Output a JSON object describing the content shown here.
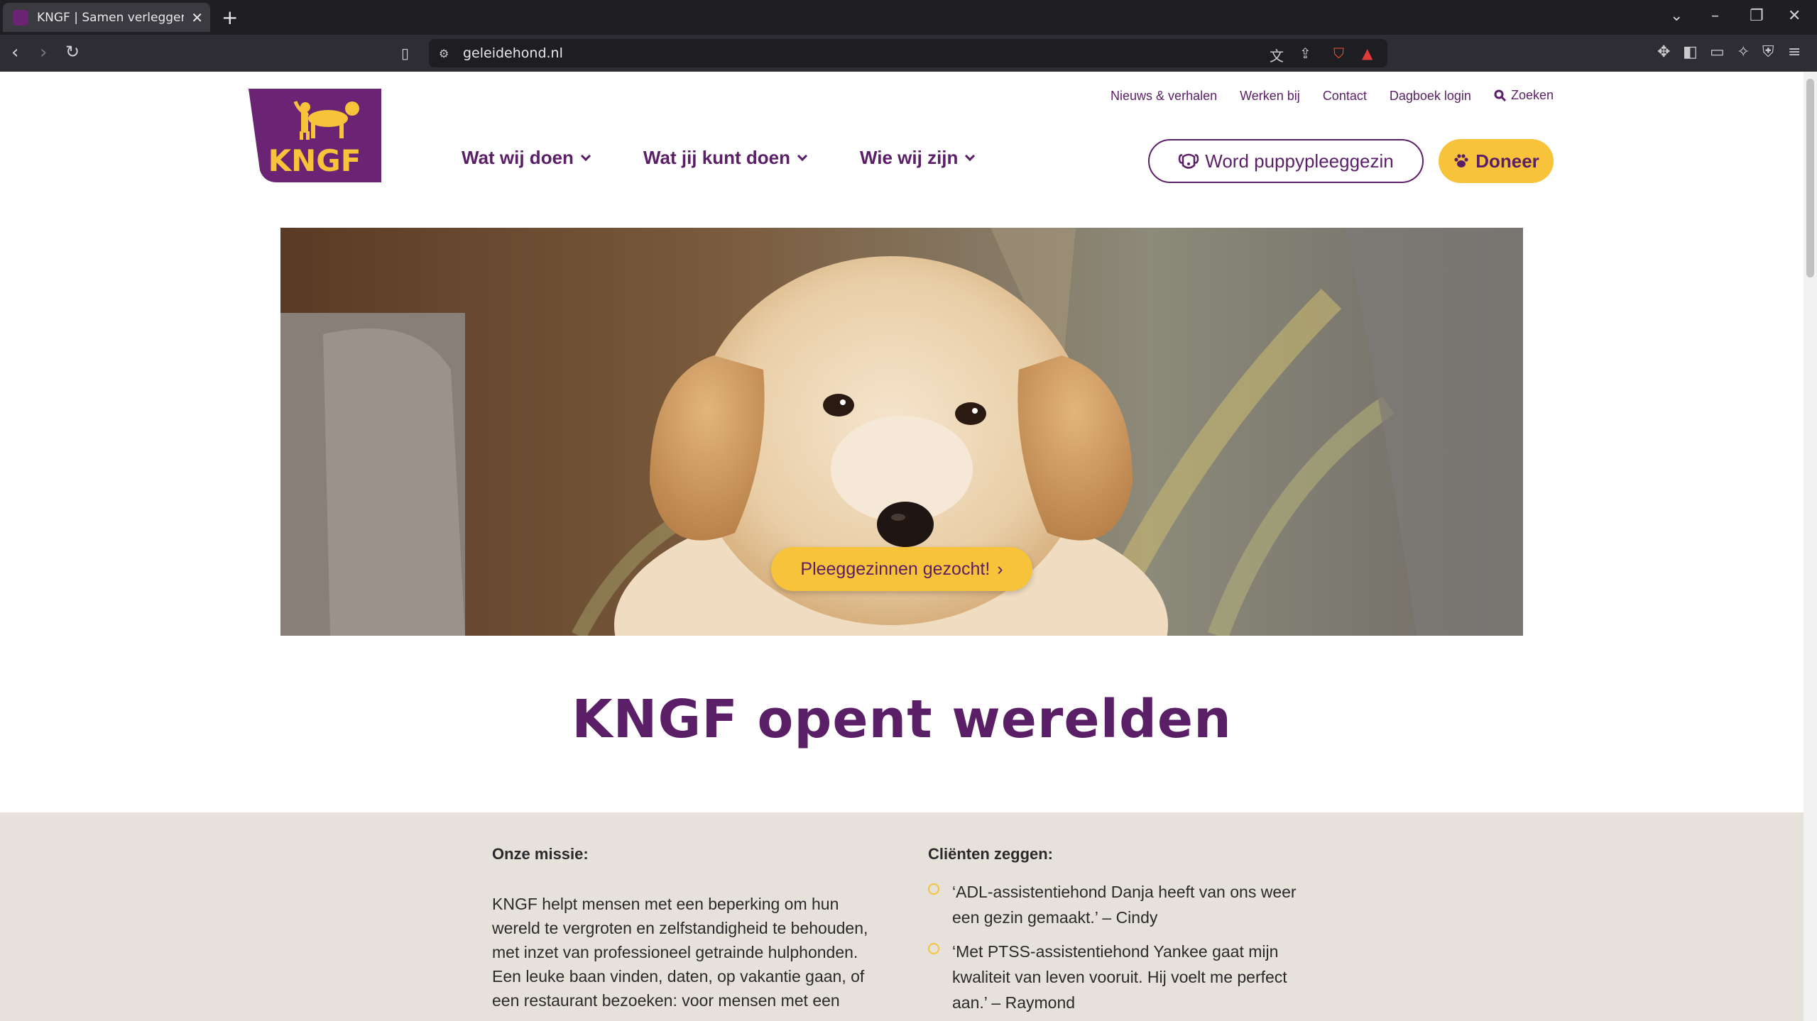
{
  "browser": {
    "tab_title": "KNGF | Samen verleggen wij gr",
    "url": "geleidehond.nl"
  },
  "site": {
    "logo_text": "KNGF",
    "utility_nav": [
      "Nieuws & verhalen",
      "Werken bij",
      "Contact",
      "Dagboek login"
    ],
    "search_label": "Zoeken",
    "main_nav": [
      "Wat wij doen",
      "Wat jij kunt doen",
      "Wie wij zijn"
    ],
    "cta_puppy": "Word puppypleeggezin",
    "cta_doneer": "Doneer"
  },
  "hero": {
    "cta": "Pleeggezinnen gezocht!"
  },
  "headline": "KNGF opent werelden",
  "mission": {
    "heading": "Onze missie:",
    "text": "KNGF helpt mensen met een beperking om hun wereld te vergroten en zelfstandigheid te behouden, met inzet van professioneel getrainde hulphonden. Een leuke baan vinden, daten, op vakantie gaan, of een restaurant bezoeken: voor mensen met een"
  },
  "clients": {
    "heading": "Cliënten zeggen:",
    "quotes": [
      "‘ADL-assistentiehond Danja heeft van ons weer een gezin gemaakt.’ – Cindy",
      "‘Met PTSS-assistentiehond Yankee gaat mijn kwaliteit van leven vooruit. Hij voelt me perfect aan.’ – Raymond"
    ]
  },
  "colors": {
    "brand_purple": "#5a1f66",
    "brand_yellow": "#f6c33a",
    "band_beige": "#e6e1db"
  }
}
